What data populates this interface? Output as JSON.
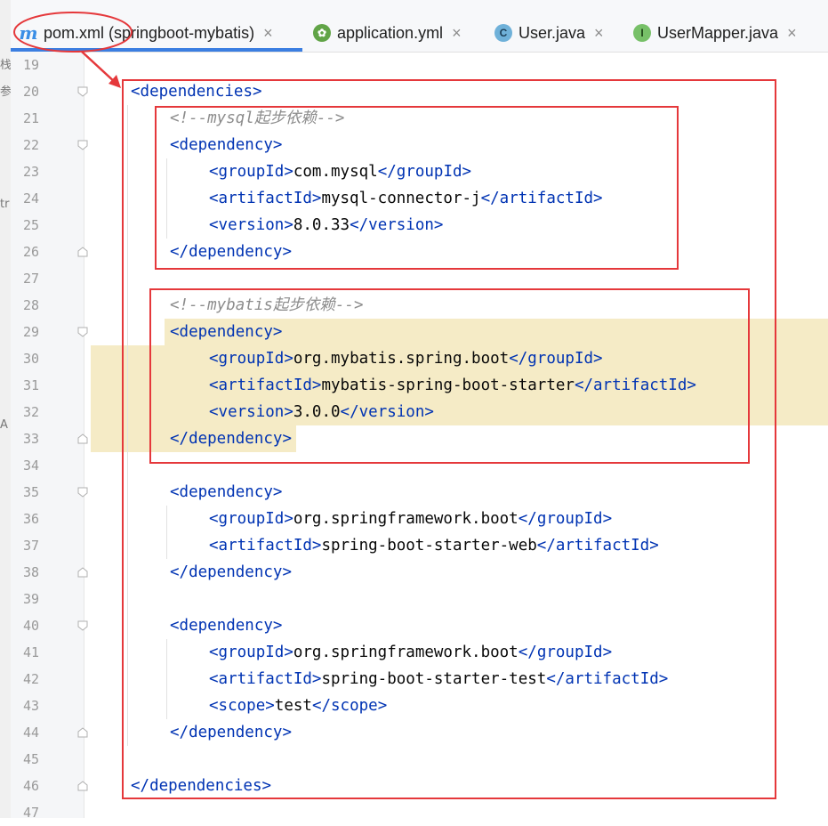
{
  "tabs": [
    {
      "label": "pom.xml (springboot-mybatis)",
      "icon": "maven-icon",
      "active": true
    },
    {
      "label": "application.yml",
      "icon": "spring-yml-icon",
      "active": false
    },
    {
      "label": "User.java",
      "icon": "class-icon",
      "active": false
    },
    {
      "label": "UserMapper.java",
      "icon": "interface-icon",
      "active": false
    }
  ],
  "gutter": {
    "line_numbers": [
      "19",
      "20",
      "21",
      "22",
      "23",
      "24",
      "25",
      "26",
      "27",
      "28",
      "29",
      "30",
      "31",
      "32",
      "33",
      "34",
      "35",
      "36",
      "37",
      "38",
      "39",
      "40",
      "41",
      "42",
      "43",
      "44",
      "45",
      "46",
      "47"
    ]
  },
  "code": {
    "l20": {
      "open": "<",
      "tag": "dependencies",
      "close": ">"
    },
    "l21": {
      "comment": "<!--mysql起步依赖-->"
    },
    "l22": {
      "tag": "dependency"
    },
    "l23": {
      "tag1": "groupId",
      "text": "com.mysql",
      "tag2": "groupId"
    },
    "l24": {
      "tag1": "artifactId",
      "text": "mysql-connector-j",
      "tag2": "artifactId"
    },
    "l25": {
      "tag1": "version",
      "text": "8.0.33",
      "tag2": "version"
    },
    "l26": {
      "tag": "dependency"
    },
    "l28": {
      "comment": "<!--mybatis起步依赖-->"
    },
    "l29": {
      "tag": "dependency"
    },
    "l30": {
      "tag1": "groupId",
      "text": "org.mybatis.spring.boot",
      "tag2": "groupId"
    },
    "l31": {
      "tag1": "artifactId",
      "text": "mybatis-spring-boot-starter",
      "tag2": "artifactId"
    },
    "l32": {
      "tag1": "version",
      "text": "3.0.0",
      "tag2": "version"
    },
    "l33": {
      "tag": "dependency"
    },
    "l35": {
      "tag": "dependency"
    },
    "l36": {
      "tag1": "groupId",
      "text": "org.springframework.boot",
      "tag2": "groupId"
    },
    "l37": {
      "tag1": "artifactId",
      "text": "spring-boot-starter-web",
      "tag2": "artifactId"
    },
    "l38": {
      "tag": "dependency"
    },
    "l40": {
      "tag": "dependency"
    },
    "l41": {
      "tag1": "groupId",
      "text": "org.springframework.boot",
      "tag2": "groupId"
    },
    "l42": {
      "tag1": "artifactId",
      "text": "spring-boot-starter-test",
      "tag2": "artifactId"
    },
    "l43": {
      "tag1": "scope",
      "text": "test",
      "tag2": "scope"
    },
    "l44": {
      "tag": "dependency"
    },
    "l46": {
      "tag": "dependencies"
    }
  },
  "colors": {
    "tag": "#0033b3",
    "comment": "#8c8c8c",
    "highlight": "#f5ebc6",
    "annotation": "#e5383b",
    "active_tab": "#3b7ee1"
  }
}
